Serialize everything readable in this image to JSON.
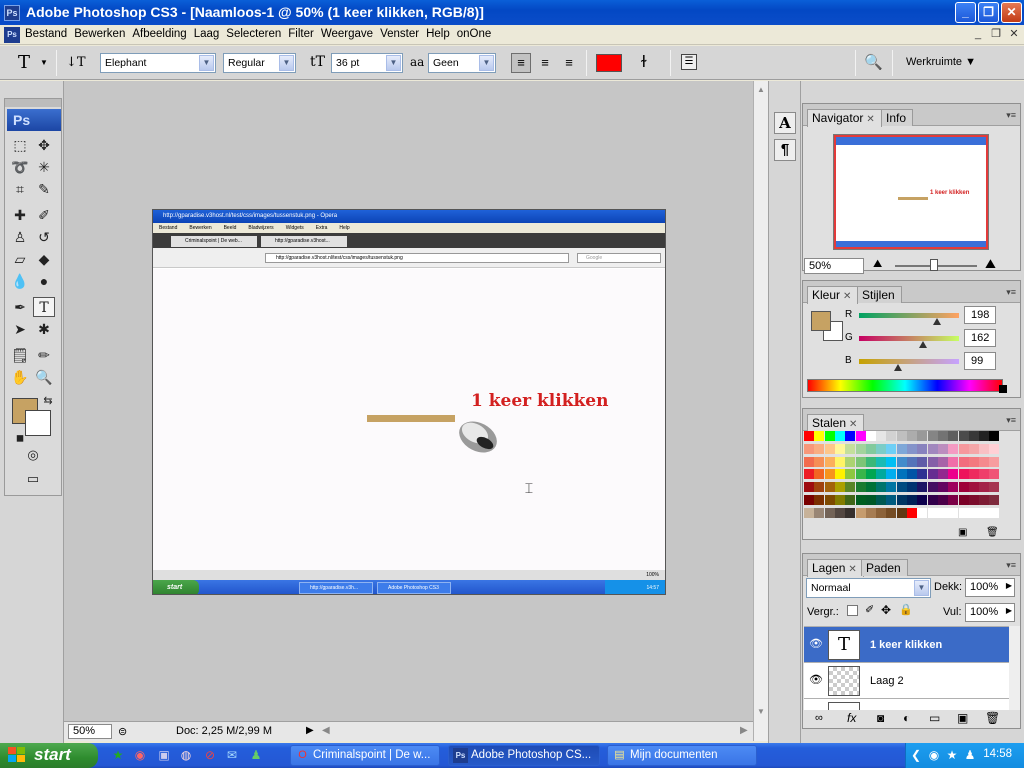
{
  "window": {
    "title": "Adobe Photoshop CS3 - [Naamloos-1 @ 50% (1 keer klikken, RGB/8)]",
    "app_icon": "Ps",
    "buttons": {
      "minimize": "_",
      "maximize": "❐",
      "close": "✕"
    }
  },
  "menu": {
    "doc_icon": "Ps",
    "items": [
      "Bestand",
      "Bewerken",
      "Afbeelding",
      "Laag",
      "Selecteren",
      "Filter",
      "Weergave",
      "Venster",
      "Help",
      "onOne"
    ],
    "mdi": {
      "minimize": "_",
      "restore": "❐",
      "close": "✕"
    }
  },
  "options": {
    "tool_glyph": "T",
    "orient_glyph": "↓T",
    "font_family": "Elephant",
    "font_style": "Regular",
    "size_glyph": "tT",
    "font_size": "36 pt",
    "aa_glyph": "aa",
    "antialias": "Geen",
    "text_color": "#ff0000",
    "workspace_label": "Werkruimte"
  },
  "toolbox": {
    "logo": "Ps",
    "fg_color": "#c6a263",
    "bg_color": "#ffffff"
  },
  "document": {
    "opera_title": "http://gparadise.v3host.nl/test/css/images/tussenstuk.png - Opera",
    "opera_menu": [
      "Bestand",
      "Bewerken",
      "Beeld",
      "Bladwijzers",
      "Widgets",
      "Extra",
      "Help"
    ],
    "tab1": "Criminalspoint | De web...",
    "tab2": "http://gparadise.v3host...",
    "url": "http://gparadise.v3host.nl/test/css/images/tussenstuk.png",
    "search_placeholder": "Google",
    "layer_text": "1 keer klikken",
    "bar_color": "#c6a263",
    "opera_zoom": "100%",
    "xp_start": "start",
    "xp_task1": "http://gparadise.v3h...",
    "xp_task2": "Adobe Photoshop CS3",
    "xp_clock": "14:57"
  },
  "statusbar": {
    "zoom": "50%",
    "doc_size": "Doc: 2,25 M/2,99 M"
  },
  "navigator": {
    "tab_active": "Navigator",
    "tab_other": "Info",
    "zoom": "50%",
    "thumb_text": "1 keer klikken"
  },
  "color_panel": {
    "tab_active": "Kleur",
    "tab_other": "Stijlen",
    "r_label": "R",
    "g_label": "G",
    "b_label": "B",
    "r": "198",
    "g": "162",
    "b": "99"
  },
  "swatches_panel": {
    "tab_active": "Stalen"
  },
  "layers_panel": {
    "tab_active": "Lagen",
    "tab_other": "Paden",
    "blend_mode": "Normaal",
    "opacity_label": "Dekk:",
    "opacity": "100%",
    "lock_label": "Vergr.:",
    "fill_label": "Vul:",
    "fill": "100%",
    "layers": [
      {
        "name": "1 keer klikken",
        "thumb": "T",
        "active": true
      },
      {
        "name": "Laag 2",
        "thumb": "",
        "active": false
      }
    ]
  },
  "taskbar": {
    "start": "start",
    "buttons": [
      "Criminalspoint | De w...",
      "Adobe Photoshop CS...",
      "Mijn documenten"
    ],
    "clock": "14:58"
  }
}
